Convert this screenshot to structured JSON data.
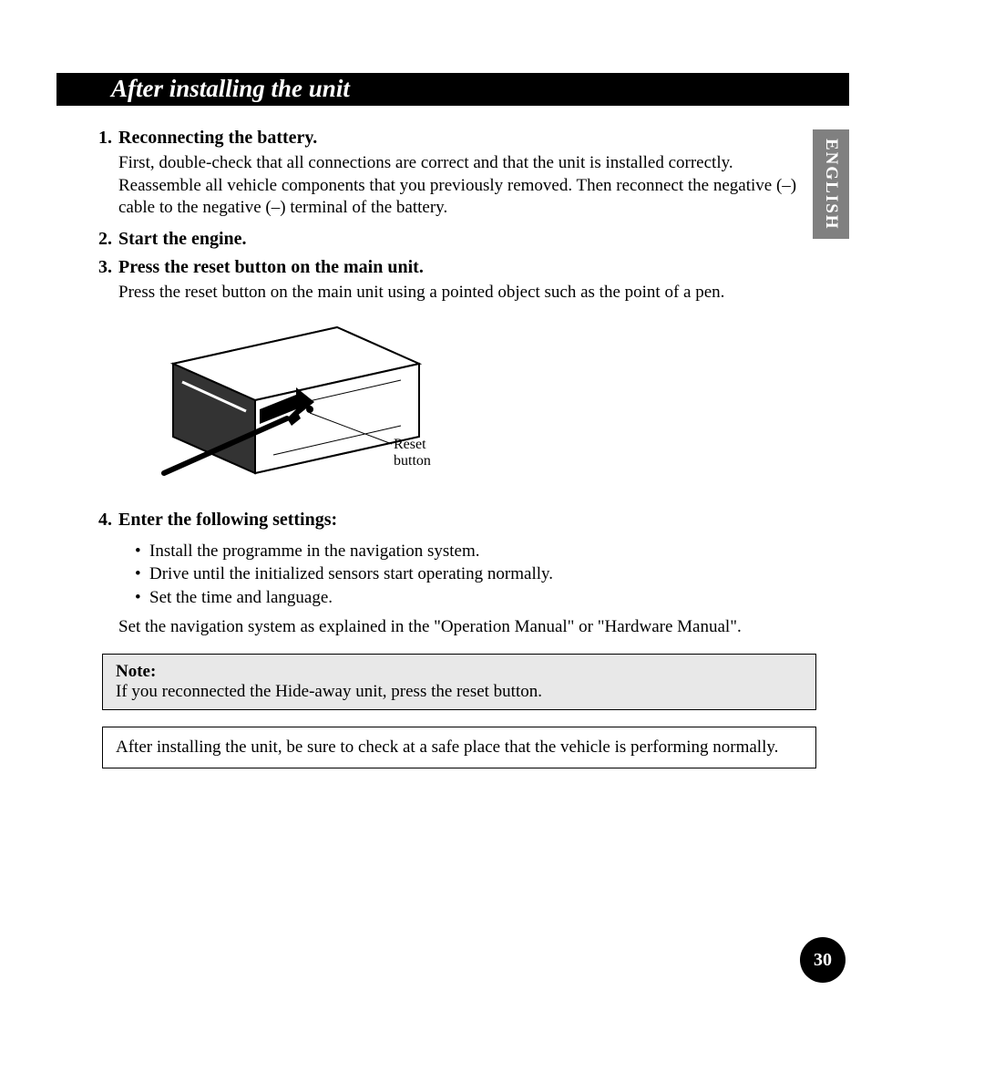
{
  "header": {
    "title": "After installing the unit"
  },
  "language_tab": "ENGLISH",
  "steps": [
    {
      "num": "1.",
      "heading": "Reconnecting the battery.",
      "body": "First, double-check that all connections are correct and that the unit is installed correctly. Reassemble all vehicle components that you previously removed. Then reconnect the negative (–) cable to the negative (–) terminal of the battery."
    },
    {
      "num": "2.",
      "heading": "Start the engine.",
      "body": ""
    },
    {
      "num": "3.",
      "heading": "Press the reset button on the main unit.",
      "body": "Press the reset button on the main unit using a pointed object such as the point of a pen."
    },
    {
      "num": "4.",
      "heading": "Enter the following settings:",
      "body": ""
    }
  ],
  "illustration": {
    "label": "Reset button"
  },
  "bullets": [
    "Install the programme in the navigation system.",
    "Drive until the initialized sensors start operating normally.",
    "Set the time and language."
  ],
  "settings_footer": "Set the navigation system as explained in the \"Operation Manual\" or \"Hardware Manual\".",
  "note": {
    "label": "Note:",
    "text": "If you reconnected the Hide-away unit, press the reset button."
  },
  "warning": "After installing the unit, be sure to check at a safe place that the vehicle is performing normally.",
  "page_number": "30"
}
